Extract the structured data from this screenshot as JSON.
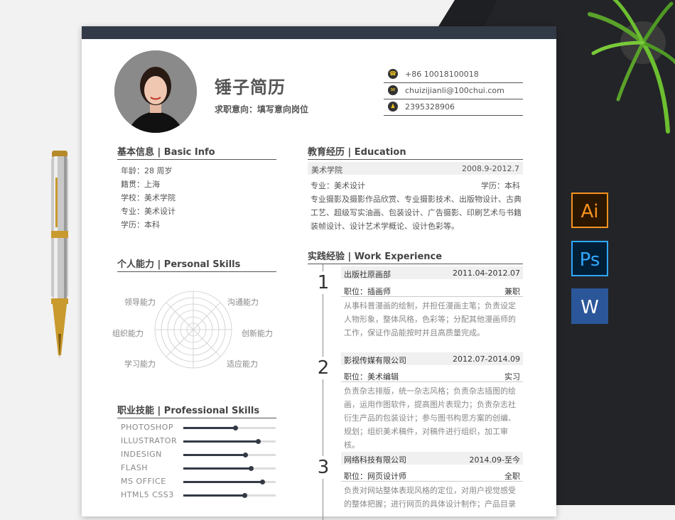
{
  "header": {
    "name": "锤子简历",
    "intent": "求职意向：填写意向岗位"
  },
  "contacts": [
    {
      "icon": "phone-icon",
      "text": "+86 10018100018"
    },
    {
      "icon": "mail-icon",
      "text": "chuizijianli@100chui.com"
    },
    {
      "icon": "qq-icon",
      "text": "2395328906"
    }
  ],
  "basic": {
    "title": "基本信息 | Basic Info",
    "lines": [
      "年龄：28 周岁",
      "籍贯：上海",
      "学校：美术学院",
      "专业：美术设计",
      "学历：本科"
    ]
  },
  "skills_personal": {
    "title": "个人能力 | Personal Skills",
    "labels": [
      "领导能力",
      "沟通能力",
      "组织能力",
      "创新能力",
      "学习能力",
      "适应能力"
    ]
  },
  "skills_pro": {
    "title": "职业技能 | Professional Skills",
    "items": [
      {
        "name": "PHOTOSHOP",
        "level": 0.56
      },
      {
        "name": "ILLUSTRATOR",
        "level": 0.81
      },
      {
        "name": "INDESIGN",
        "level": 0.67
      },
      {
        "name": "FLASH",
        "level": 0.73
      },
      {
        "name": "MS OFFICE",
        "level": 0.85
      },
      {
        "name": "HTML5 CSS3",
        "level": 0.66
      }
    ]
  },
  "education": {
    "title": "教育经历 | Education",
    "school": "美术学院",
    "period": "2008.9-2012.7",
    "major": "专业：美术设计",
    "degree": "学历：本科",
    "desc": "专业摄影及摄影作品欣赏、专业摄影技术、出版物设计、古典工艺、超级写实油画、包装设计、广告摄影、印刷艺术与书籍装帧设计、设计艺术学概论、设计色彩等。"
  },
  "work": {
    "title": "实践经验 | Work Experience",
    "jobs": [
      {
        "num": "1",
        "company": "出版社原画部",
        "period": "2011.04-2012.07",
        "role": "职位：插画师",
        "type": "兼职",
        "desc": "从事科普漫画的绘制，并担任漫画主笔；负责设定人物形象，整体风格，色彩等；分配其他漫画师的工作，保证作品能按时并且高质量完成。"
      },
      {
        "num": "2",
        "company": "影视传媒有限公司",
        "period": "2012.07-2014.09",
        "role": "职位：美术编辑",
        "type": "实习",
        "desc": "负责杂志排版，统一杂志风格；负责杂志插图的绘画，运用作图软件，提高图片表现力；负责杂志社衍生产品的包装设计；参与图书构思方案的创编、规划；组织美术稿件，对稿件进行组织，加工审核。"
      },
      {
        "num": "3",
        "company": "网络科技有限公司",
        "period": "2014.09-至今",
        "role": "职位：网页设计师",
        "type": "全职",
        "desc": "负责对网站整体表现风格的定位，对用户视觉感受的整体把握；进行网页的具体设计制作；产品目录"
      }
    ]
  },
  "apps": [
    {
      "name": "ai-icon",
      "label": "Ai",
      "bg": "#2b1600",
      "fg": "#f7931e",
      "border": "#f7931e"
    },
    {
      "name": "ps-icon",
      "label": "Ps",
      "bg": "#001e36",
      "fg": "#31a8ff",
      "border": "#31a8ff"
    },
    {
      "name": "word-icon",
      "label": "W",
      "bg": "#2b579a",
      "fg": "#ffffff",
      "border": "#2b579a"
    }
  ]
}
